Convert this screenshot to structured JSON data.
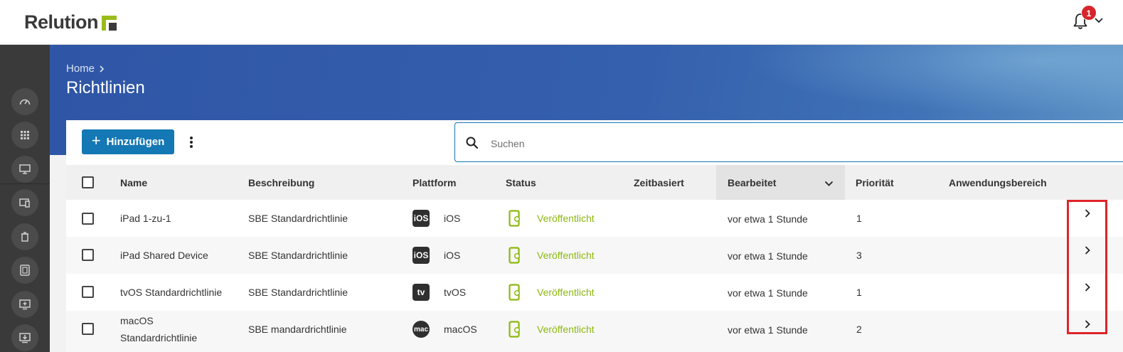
{
  "app": {
    "name": "Relution",
    "notification_count": "1"
  },
  "breadcrumb": {
    "home": "Home"
  },
  "page": {
    "title": "Richtlinien"
  },
  "toolbar": {
    "add_label": "Hinzufügen"
  },
  "search": {
    "placeholder": "Suchen"
  },
  "table": {
    "columns": {
      "name": "Name",
      "description": "Beschreibung",
      "platform": "Plattform",
      "status": "Status",
      "time_based": "Zeitbasiert",
      "edited": "Bearbeitet",
      "priority": "Priorität",
      "scope": "Anwendungsbereich"
    },
    "sorted_column": "Bearbeitet",
    "rows": [
      {
        "name_line1": "iPad 1-zu-1",
        "name_line2": "",
        "description": "SBE Standardrichtlinie",
        "platform_icon": "iOS",
        "platform": "iOS",
        "status": "Veröffentlicht",
        "edited": "vor etwa 1 Stunde",
        "priority": "1"
      },
      {
        "name_line1": "iPad Shared Device",
        "name_line2": "",
        "description": "SBE Standardrichtlinie",
        "platform_icon": "iOS",
        "platform": "iOS",
        "status": "Veröffentlicht",
        "edited": "vor etwa 1 Stunde",
        "priority": "3"
      },
      {
        "name_line1": "tvOS Standardrichtlinie",
        "name_line2": "",
        "description": "SBE Standardrichtlinie",
        "platform_icon": "tv",
        "platform": "tvOS",
        "status": "Veröffentlicht",
        "edited": "vor etwa 1 Stunde",
        "priority": "1"
      },
      {
        "name_line1": "macOS",
        "name_line2": "Standardrichtlinie",
        "description": "SBE mandardrichtlinie",
        "platform_icon": "mac",
        "platform": "macOS",
        "status": "Veröffentlicht",
        "edited": "vor etwa 1 Stunde",
        "priority": "2"
      }
    ]
  },
  "sidebar": {
    "icons": [
      "dashboard-icon",
      "apps-grid-icon",
      "devices-icon",
      "device-policy-icon",
      "trash-icon",
      "tablet-icon",
      "add-screen-icon",
      "download-device-icon"
    ]
  },
  "colors": {
    "primary": "#1478b4",
    "banner": "#2f56a6",
    "status_published": "#8cb80f",
    "badge": "#d7262b",
    "highlight": "#e0232a",
    "logo_green": "#9bbb1a"
  }
}
